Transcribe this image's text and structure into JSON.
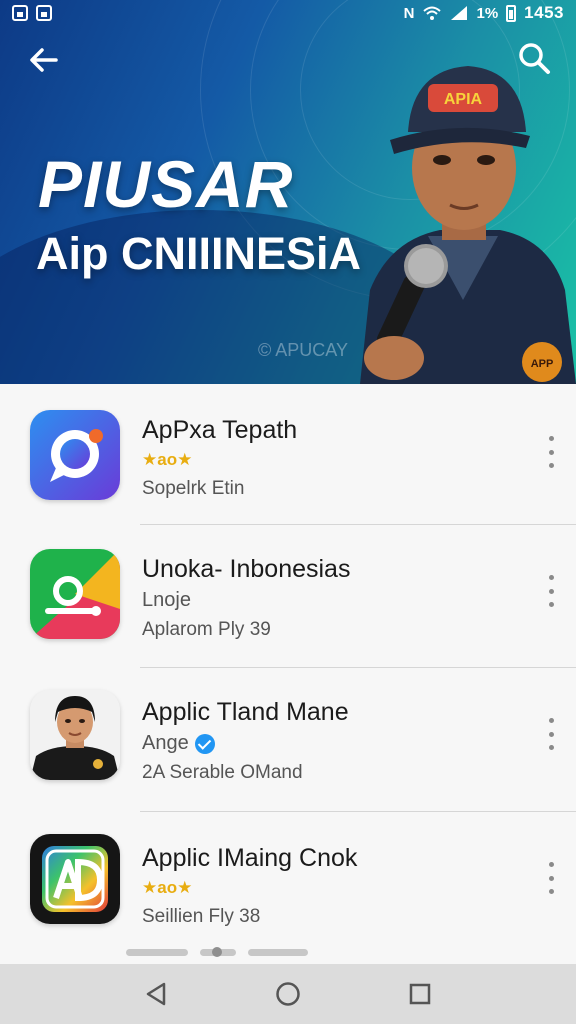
{
  "status_bar": {
    "network_text": "N",
    "battery_percent": "1%",
    "time": "1453",
    "icons": [
      "gallery-icon",
      "image-icon",
      "nfc-icon",
      "wifi-icon",
      "signal-icon",
      "battery-icon"
    ]
  },
  "hero": {
    "title": "PIUSAR",
    "subtitle": "Aip CNIIINESiA",
    "watermark": "APUCAY",
    "back_icon": "arrow-left-icon",
    "search_icon": "search-icon",
    "presenter_cap_text": "APIA",
    "presenter_badge_text": "APP",
    "colors": {
      "gradient_start": "#0d3a86",
      "gradient_end": "#1ac2a6"
    }
  },
  "apps": [
    {
      "name": "ApPxa Tepath",
      "line2_stars": "★ao★",
      "line2_text": "",
      "line3": "Sopelrk Etin",
      "icon": "chat-bubble-app-icon"
    },
    {
      "name": "Unoka- Inbonesias",
      "line2_stars": "",
      "line2_text": "Lnoje",
      "line3": "Aplarom Ply 39",
      "icon": "colorful-logo-app-icon"
    },
    {
      "name": "Applic Tland Mane",
      "line2_stars": "",
      "line2_text": "Ange",
      "line3": "2A Serable OMand",
      "icon": "person-avatar-app-icon",
      "verified": true
    },
    {
      "name": "Applic IMaing Cnok",
      "line2_stars": "★ao★",
      "line2_text": "",
      "line3": "Seillien Fly 38",
      "icon": "ad-logo-app-icon"
    }
  ],
  "nav": {
    "back_icon": "nav-back-icon",
    "home_icon": "nav-home-icon",
    "recents_icon": "nav-recents-icon"
  },
  "accent_colors": {
    "star": "#e8ad11",
    "verified": "#2196f3"
  }
}
